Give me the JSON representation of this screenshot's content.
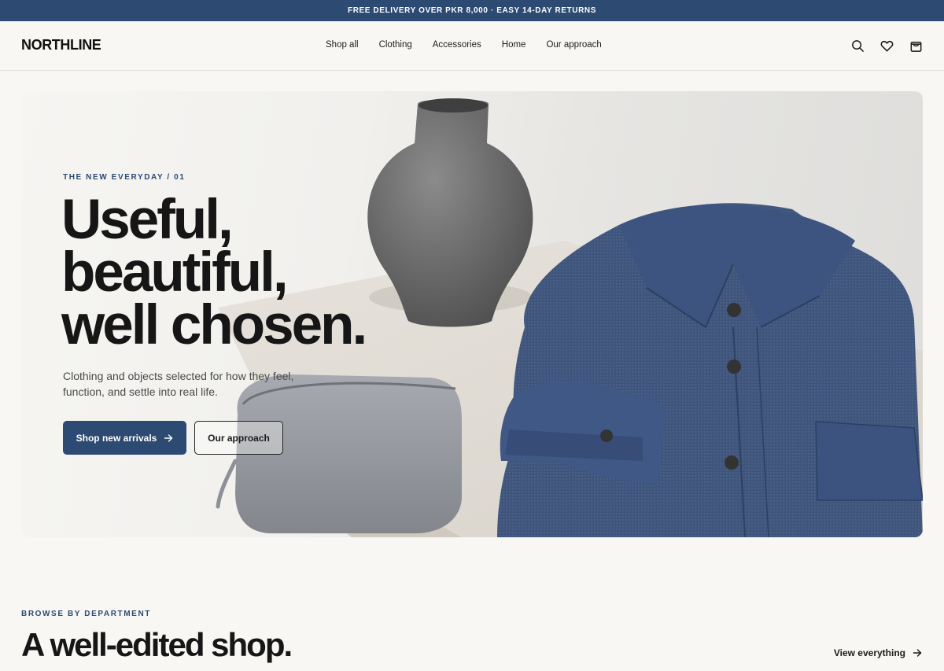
{
  "announcement": {
    "text": "FREE DELIVERY OVER PKR 8,000 · EASY 14-DAY RETURNS"
  },
  "header": {
    "logo": "NORTHLINE",
    "nav": [
      "Shop all",
      "Clothing",
      "Accessories",
      "Home",
      "Our approach"
    ],
    "icons": [
      "search-icon",
      "heart-icon",
      "bag-icon"
    ]
  },
  "hero": {
    "eyebrow": "THE NEW EVERYDAY / 01",
    "headline": [
      "Useful,",
      "beautiful,",
      "well chosen."
    ],
    "subtext": "Clothing and objects selected for how they feel, function, and settle into real life.",
    "primary_button": "Shop new arrivals",
    "secondary_button": "Our approach"
  },
  "browse": {
    "eyebrow": "BROWSE BY DEPARTMENT",
    "title": "A well-edited shop.",
    "view_all": "View everything"
  },
  "colors": {
    "accent": "#2c4a72",
    "background": "#f8f7f4",
    "text": "#161616"
  }
}
